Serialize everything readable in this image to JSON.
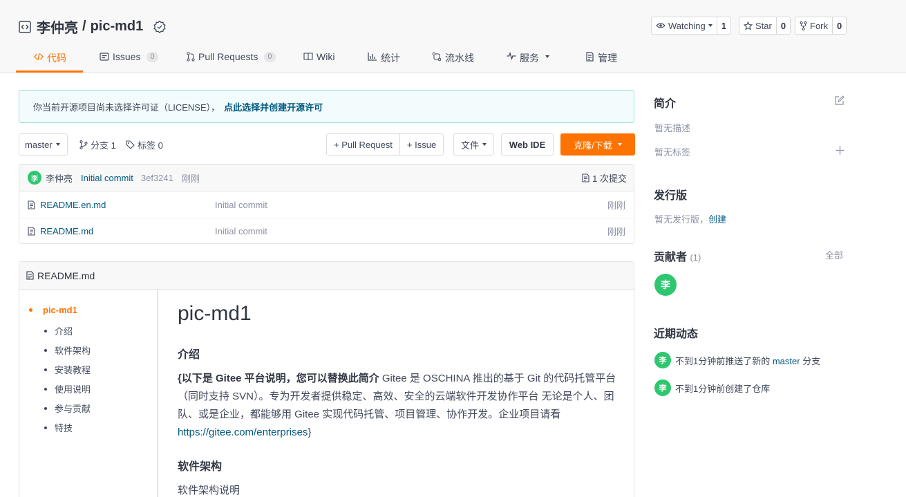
{
  "repo": {
    "owner": "李仲亮",
    "separator": "/",
    "name": "pic-md1"
  },
  "actions": {
    "watch": {
      "label": "Watching",
      "count": "1"
    },
    "star": {
      "label": "Star",
      "count": "0"
    },
    "fork": {
      "label": "Fork",
      "count": "0"
    }
  },
  "tabs": [
    {
      "label": "代码",
      "icon": "code-icon",
      "active": true
    },
    {
      "label": "Issues",
      "count": "0",
      "icon": "issues-icon"
    },
    {
      "label": "Pull Requests",
      "count": "0",
      "icon": "pull-request-icon"
    },
    {
      "label": "Wiki",
      "icon": "wiki-icon"
    },
    {
      "label": "统计",
      "icon": "chart-icon"
    },
    {
      "label": "流水线",
      "icon": "pipeline-icon"
    },
    {
      "label": "服务",
      "icon": "pulse-icon"
    },
    {
      "label": "管理",
      "icon": "settings-doc-icon"
    }
  ],
  "notice": {
    "text": "你当前开源项目尚未选择许可证（LICENSE），",
    "link": "点此选择并创建开源许可"
  },
  "toolbar": {
    "branch": "master",
    "branches_label": "分支 1",
    "tags_label": "标签 0",
    "pull_request": "+ Pull Request",
    "issue": "+ Issue",
    "file": "文件",
    "web_ide": "Web IDE",
    "clone": "克隆/下载"
  },
  "last_commit": {
    "avatar": "李",
    "author": "李仲亮",
    "message": "Initial commit",
    "sha": "3ef3241",
    "time": "刚刚",
    "commits": "1 次提交"
  },
  "files": [
    {
      "name": "README.en.md",
      "message": "Initial commit",
      "time": "刚刚"
    },
    {
      "name": "README.md",
      "message": "Initial commit",
      "time": "刚刚"
    }
  ],
  "readme": {
    "filename": "README.md",
    "toc_top": "pic-md1",
    "toc": [
      "介绍",
      "软件架构",
      "安装教程",
      "使用说明",
      "参与贡献",
      "特技"
    ],
    "title": "pic-md1",
    "intro_heading": "介绍",
    "intro_bold": "{以下是 Gitee 平台说明，您可以替换此简介",
    "intro_text": " Gitee 是 OSCHINA 推出的基于 Git 的代码托管平台（同时支持 SVN）。专为开发者提供稳定、高效、安全的云端软件开发协作平台 无论是个人、团队、或是企业，都能够用 Gitee 实现代码托管、项目管理、协作开发。企业项目请看 ",
    "intro_link": "https://gitee.com/enterprises",
    "intro_tail": "}",
    "arch_heading": "软件架构",
    "arch_text": "软件架构说明"
  },
  "sidebar": {
    "intro_title": "简介",
    "no_desc": "暂无描述",
    "no_tags": "暂无标签",
    "release_title": "发行版",
    "no_release": "暂无发行版，",
    "create": "创建",
    "contrib_title": "贡献者",
    "contrib_count": "(1)",
    "all": "全部",
    "contrib_avatar": "李",
    "activity_title": "近期动态",
    "activity": [
      {
        "avatar": "李",
        "prefix": "不到1分钟前推送了新的 ",
        "link": "master",
        "suffix": " 分支"
      },
      {
        "avatar": "李",
        "prefix": "不到1分钟前创建了仓库",
        "link": "",
        "suffix": ""
      }
    ]
  },
  "colors": {
    "accent": "#fe7300",
    "link": "#005980",
    "avatar": "#2ec770"
  }
}
